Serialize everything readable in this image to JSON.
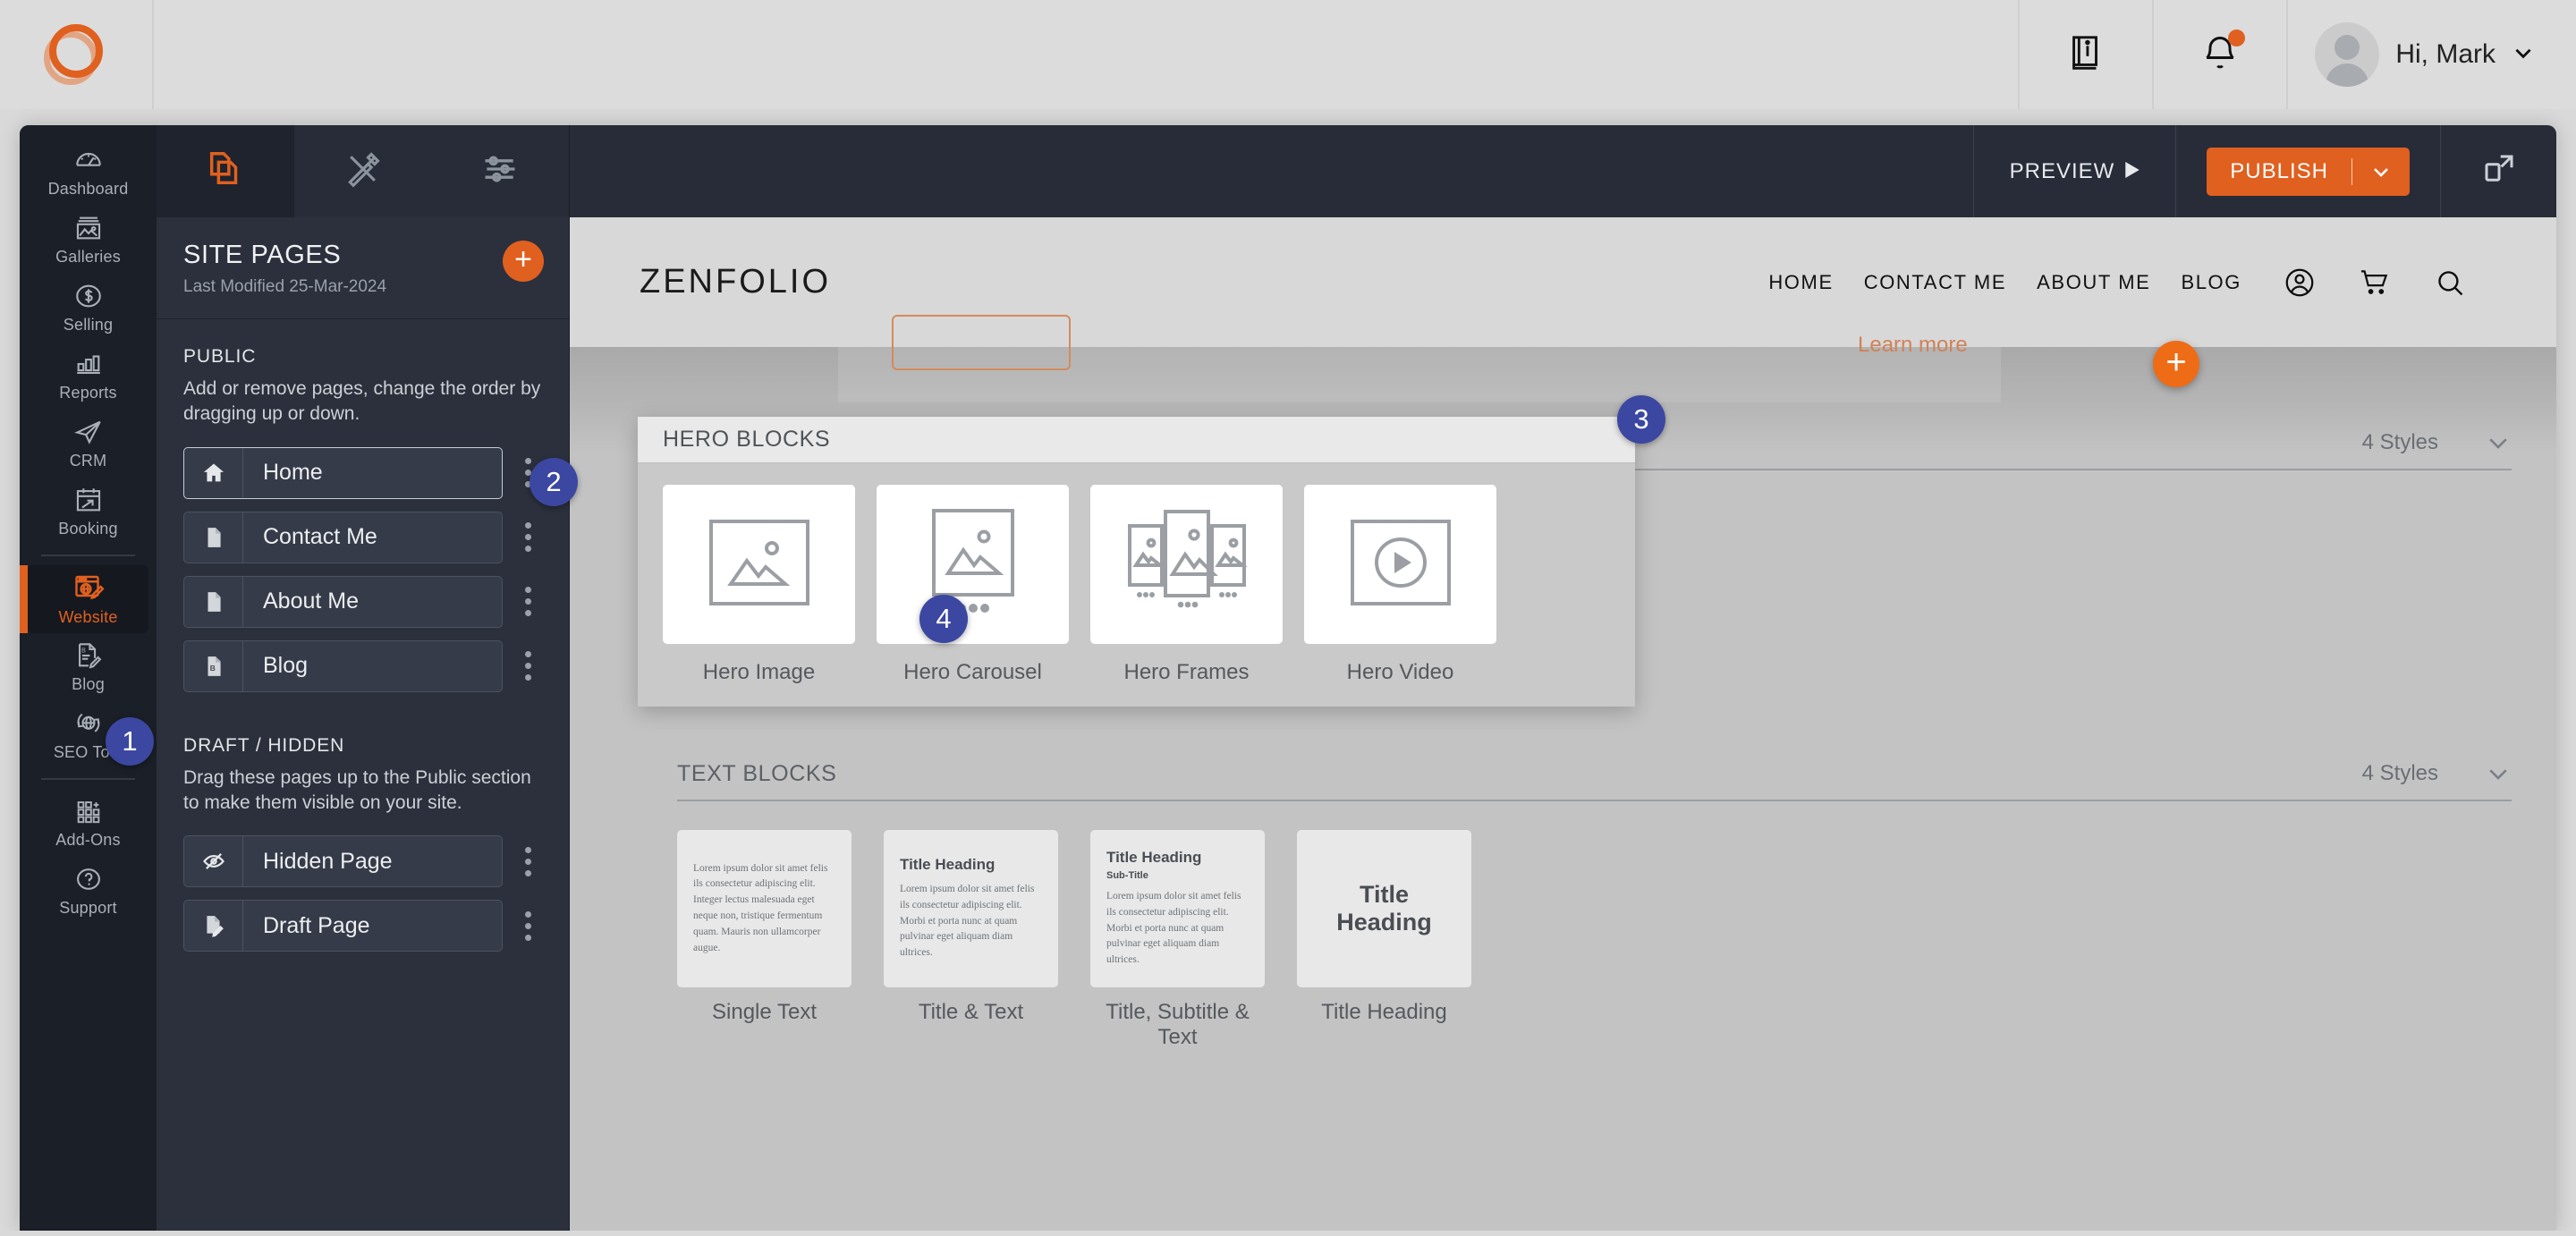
{
  "app_header": {
    "logo_icon": "zenfolio-ring-logo",
    "help_icon": "book-info-icon",
    "notifications_icon": "bell-icon",
    "notification_badge_color": "#e0601f",
    "avatar_icon": "user-avatar",
    "user_greeting": "Hi, Mark",
    "user_caret_icon": "chevron-down-icon"
  },
  "rail": {
    "items": [
      {
        "label": "Dashboard",
        "icon": "speedometer-icon",
        "active": false
      },
      {
        "label": "Galleries",
        "icon": "photo-stack-icon",
        "active": false
      },
      {
        "label": "Selling",
        "icon": "dollar-circle-icon",
        "active": false
      },
      {
        "label": "Reports",
        "icon": "bar-chart-icon",
        "active": false
      },
      {
        "label": "CRM",
        "icon": "paper-plane-icon",
        "active": false
      },
      {
        "label": "Booking",
        "icon": "calendar-arrow-icon",
        "active": false
      },
      {
        "label": "Website",
        "icon": "browser-globe-pencil-icon",
        "active": true
      },
      {
        "label": "Blog",
        "icon": "document-pencil-icon",
        "active": false
      },
      {
        "label": "SEO Tool",
        "icon": "globe-magnifier-icon",
        "active": false
      },
      {
        "label": "Add-Ons",
        "icon": "grid-plus-icon",
        "active": false
      },
      {
        "label": "Support",
        "icon": "question-circle-icon",
        "active": false
      }
    ],
    "active_color": "#e0601f"
  },
  "panel": {
    "tabs": [
      {
        "icon": "pages-copy-icon",
        "active": true
      },
      {
        "icon": "design-tools-icon",
        "active": false
      },
      {
        "icon": "sliders-settings-icon",
        "active": false
      }
    ],
    "title": "SITE PAGES",
    "last_modified": "Last Modified 25-Mar-2024",
    "add_button_icon": "plus-icon",
    "public": {
      "heading": "PUBLIC",
      "description": "Add or remove pages, change the order by dragging up or down.",
      "pages": [
        {
          "label": "Home",
          "icon": "home-icon",
          "selected": true
        },
        {
          "label": "Contact Me",
          "icon": "page-icon",
          "selected": false
        },
        {
          "label": "About Me",
          "icon": "page-icon",
          "selected": false
        },
        {
          "label": "Blog",
          "icon": "blog-page-icon",
          "selected": false
        }
      ]
    },
    "draft": {
      "heading": "DRAFT / HIDDEN",
      "description": "Drag these pages up to the Public section to make them visible on your site.",
      "pages": [
        {
          "label": "Hidden Page",
          "icon": "eye-slash-icon",
          "selected": false
        },
        {
          "label": "Draft Page",
          "icon": "page-pencil-icon",
          "selected": false
        }
      ]
    },
    "row_menu_icon": "kebab-menu-icon"
  },
  "toolbar": {
    "preview_label": "PREVIEW",
    "preview_icon": "play-triangle-icon",
    "publish_label": "PUBLISH",
    "publish_caret_icon": "chevron-down-icon",
    "publish_color": "#e0601f",
    "expand_icon": "expand-preview-icon"
  },
  "site_preview": {
    "logo": "ZENFOLIO",
    "nav": [
      {
        "label": "HOME"
      },
      {
        "label": "CONTACT ME"
      },
      {
        "label": "ABOUT ME"
      },
      {
        "label": "BLOG"
      }
    ],
    "icons": [
      {
        "name": "account-icon"
      },
      {
        "name": "cart-icon"
      },
      {
        "name": "search-icon"
      }
    ],
    "learn_more": "Learn more",
    "add_block_icon": "plus-icon"
  },
  "hero_popup": {
    "title": "HERO BLOCKS",
    "styles_label": "4 Styles",
    "caret_icon": "chevron-down-icon",
    "cards": [
      {
        "label": "Hero Image",
        "icon": "single-image-icon"
      },
      {
        "label": "Hero Carousel",
        "icon": "carousel-image-icon"
      },
      {
        "label": "Hero Frames",
        "icon": "frames-image-icon"
      },
      {
        "label": "Hero Video",
        "icon": "video-play-icon"
      }
    ]
  },
  "text_blocks": {
    "title": "TEXT BLOCKS",
    "styles_label": "4 Styles",
    "caret_icon": "chevron-down-icon",
    "cards": [
      {
        "label": "Single Text",
        "body": "Lorem ipsum dolor sit amet felis ils consectetur adipiscing elit. Integer lectus malesuada eget neque non, tristique fermentum quam. Mauris non ullamcorper augue."
      },
      {
        "label": "Title & Text",
        "heading": "Title Heading",
        "body": "Lorem ipsum dolor sit amet felis ils consectetur adipiscing elit. Morbi et porta nunc at quam pulvinar eget aliquam diam ultrices."
      },
      {
        "label": "Title, Subtitle & Text",
        "heading": "Title Heading",
        "subheading": "Sub-Title",
        "body": "Lorem ipsum dolor sit amet felis ils consectetur adipiscing elit. Morbi et porta nunc at quam pulvinar eget aliquam diam ultrices."
      },
      {
        "label": "Title Heading",
        "heading": "Title Heading"
      }
    ]
  },
  "callouts": [
    {
      "number": "1"
    },
    {
      "number": "2"
    },
    {
      "number": "3"
    },
    {
      "number": "4"
    }
  ],
  "colors": {
    "accent_orange": "#e0601f",
    "callout_blue": "#3b47a0",
    "panel_dark": "#2b303c",
    "rail_dark": "#1b1f27"
  }
}
